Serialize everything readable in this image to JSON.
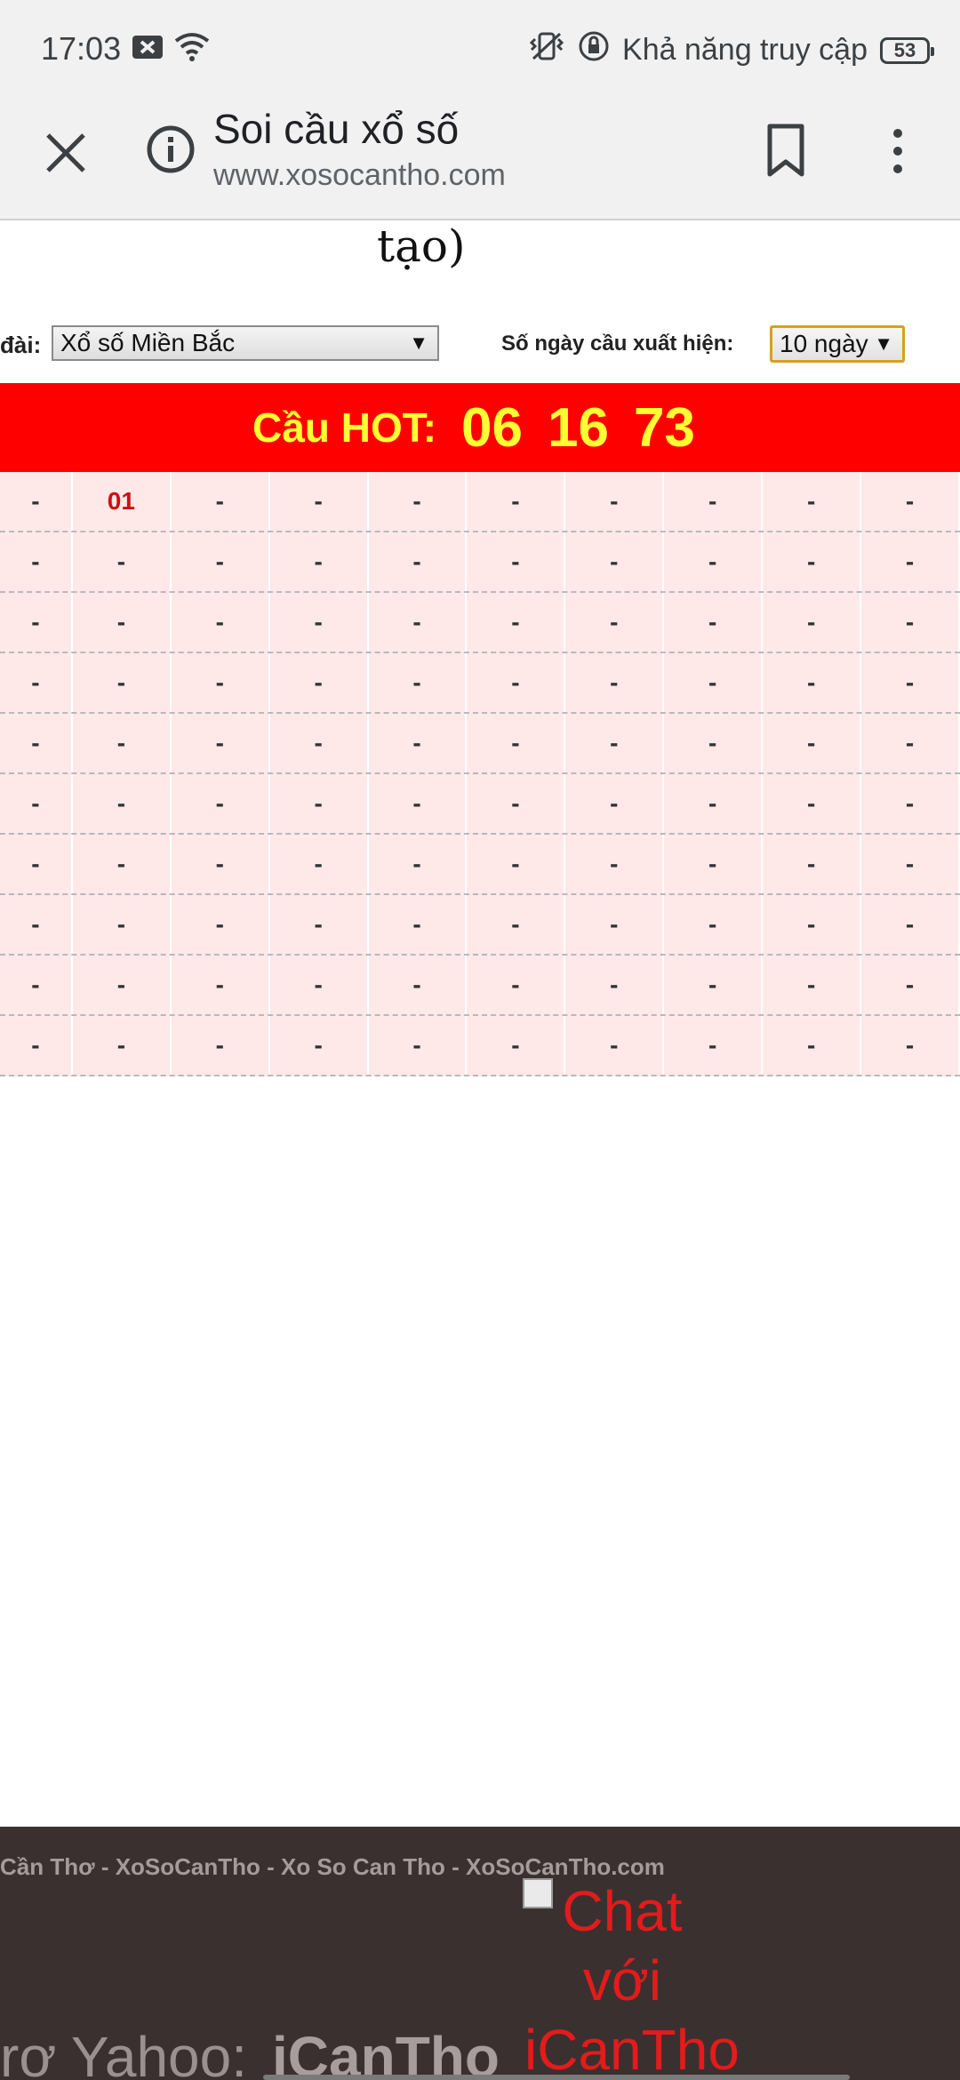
{
  "status_bar": {
    "time": "17:03",
    "accessibility_text": "Khả năng truy cập",
    "battery": "53",
    "icons": [
      "notification-x-icon",
      "wifi-icon",
      "vibrate-icon",
      "rotation-lock-icon",
      "battery-icon"
    ]
  },
  "toolbar": {
    "title": "Soi cầu xổ số",
    "url": "www.xosocantho.com",
    "icons": [
      "close-icon",
      "info-icon",
      "bookmark-icon",
      "more-vert-icon"
    ]
  },
  "page": {
    "heading_fragment": "tạo)",
    "filter": {
      "station_label": "đài:",
      "station_value": "Xổ số Miền Bắc",
      "days_label": "Số ngày cầu xuất hiện:",
      "days_value": "10 ngày"
    },
    "hot": {
      "label": "Cầu HOT:",
      "numbers": [
        "06",
        "16",
        "73"
      ]
    },
    "grid": {
      "rows": [
        [
          "-",
          "01",
          "-",
          "-",
          "-",
          "-",
          "-",
          "-",
          "-",
          "-"
        ],
        [
          "-",
          "-",
          "-",
          "-",
          "-",
          "-",
          "-",
          "-",
          "-",
          "-"
        ],
        [
          "-",
          "-",
          "-",
          "-",
          "-",
          "-",
          "-",
          "-",
          "-",
          "-"
        ],
        [
          "-",
          "-",
          "-",
          "-",
          "-",
          "-",
          "-",
          "-",
          "-",
          "-"
        ],
        [
          "-",
          "-",
          "-",
          "-",
          "-",
          "-",
          "-",
          "-",
          "-",
          "-"
        ],
        [
          "-",
          "-",
          "-",
          "-",
          "-",
          "-",
          "-",
          "-",
          "-",
          "-"
        ],
        [
          "-",
          "-",
          "-",
          "-",
          "-",
          "-",
          "-",
          "-",
          "-",
          "-"
        ],
        [
          "-",
          "-",
          "-",
          "-",
          "-",
          "-",
          "-",
          "-",
          "-",
          "-"
        ],
        [
          "-",
          "-",
          "-",
          "-",
          "-",
          "-",
          "-",
          "-",
          "-",
          "-"
        ],
        [
          "-",
          "-",
          "-",
          "-",
          "-",
          "-",
          "-",
          "-",
          "-",
          "-"
        ]
      ]
    }
  },
  "footer": {
    "copyright": "Cần Thơ - XoSoCanTho - Xo So Can Tho - XoSoCanTho.com",
    "chat_alt": "Chat với iCanTho",
    "support_label": "rợ Yahoo:",
    "support_id": "iCanTho"
  },
  "colors": {
    "hot_bar": "#ff0000",
    "hot_text": "#ffff33",
    "grid_bg": "#ffe8e8",
    "highlight": "#cc1111",
    "footer_bg": "#3a3030"
  }
}
